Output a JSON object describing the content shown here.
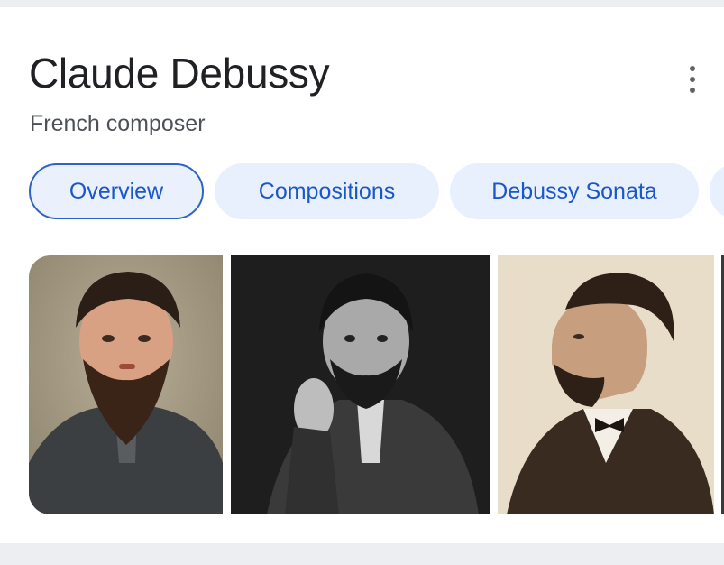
{
  "entity": {
    "title": "Claude Debussy",
    "subtitle": "French composer"
  },
  "menu": {
    "icon": "more-vert-icon"
  },
  "chips": [
    {
      "label": "Overview",
      "active": true
    },
    {
      "label": "Compositions",
      "active": false
    },
    {
      "label": "Debussy Sonata",
      "active": false
    }
  ],
  "images": [
    {
      "description_icon": "portrait-photo-color"
    },
    {
      "description_icon": "portrait-photo-bw"
    },
    {
      "description_icon": "portrait-photo-sepia"
    }
  ],
  "colors": {
    "chip_bg": "#e8f0fe",
    "chip_text": "#1a57c9",
    "active_border": "#2c63c6",
    "title": "#202124",
    "subtitle": "#4d5156"
  }
}
